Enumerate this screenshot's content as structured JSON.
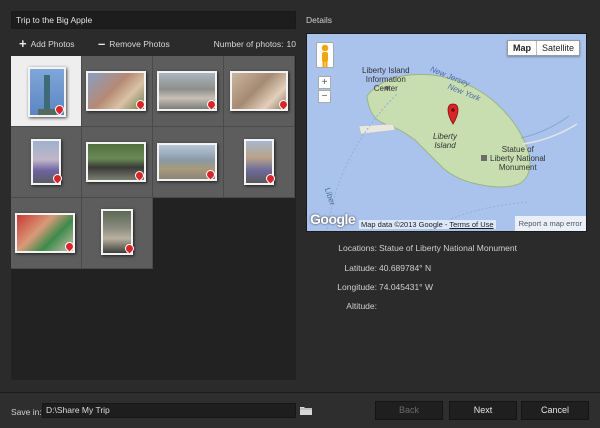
{
  "album": {
    "title": "Trip to the Big Apple"
  },
  "toolbar": {
    "add_label": "Add Photos",
    "add_icon": "plus-icon",
    "remove_label": "Remove Photos",
    "remove_icon": "minus-icon",
    "count_label": "Number of photos:",
    "count_value": "10"
  },
  "photos": [
    {
      "name": "Statue of Liberty",
      "selected": true
    },
    {
      "name": "Family group"
    },
    {
      "name": "Stroller on sidewalk"
    },
    {
      "name": "Group on steps"
    },
    {
      "name": "Kids in front of statue"
    },
    {
      "name": "Park bench"
    },
    {
      "name": "Plaza walk"
    },
    {
      "name": "Portrait vertical"
    },
    {
      "name": "Foosball game"
    },
    {
      "name": "City street"
    }
  ],
  "details": {
    "heading": "Details",
    "map": {
      "type_map": "Map",
      "type_satellite": "Satellite",
      "label_info_center": "Liberty Island\nInformation\nCenter",
      "label_new_jersey": "New Jersey",
      "label_new_york": "New York",
      "label_liberty_island": "Liberty\nIsland",
      "label_monument": "Statue of\nLiberty National\nMonument",
      "label_liberty_partial": "Liber",
      "google": "Google",
      "copyright": "Map data ©2013 Google -",
      "terms": "Terms of Use",
      "report": "Report a map error",
      "zoom_in": "+",
      "zoom_out": "−",
      "land_color": "#c8deb0",
      "water_color": "#a9c3ec"
    },
    "locations_key": "Locations:",
    "locations_val": "Statue of Liberty National Monument",
    "latitude_key": "Latitude:",
    "latitude_val": "40.689784° N",
    "longitude_key": "Longitude:",
    "longitude_val": "74.045431° W",
    "altitude_key": "Altitude:",
    "altitude_val": ""
  },
  "footer": {
    "save_label": "Save in:",
    "save_path": "D:\\Share My Trip",
    "back_label": "Back",
    "next_label": "Next",
    "cancel_label": "Cancel"
  }
}
